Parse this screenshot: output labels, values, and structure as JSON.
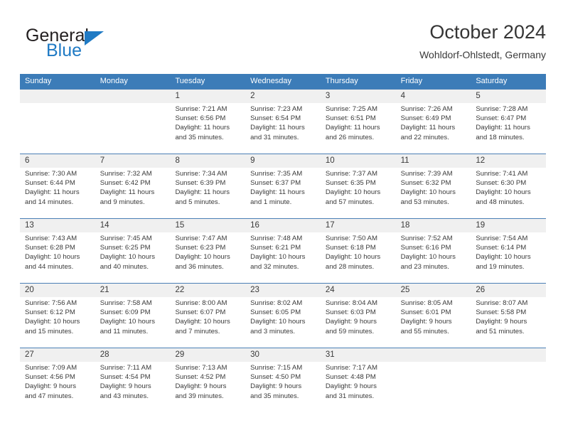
{
  "brand": {
    "name_part1": "General",
    "name_part2": "Blue",
    "triangle_color": "#1f7ac4"
  },
  "header": {
    "title": "October 2024",
    "subtitle": "Wohldorf-Ohlstedt, Germany"
  },
  "colors": {
    "header_blue": "#3c7cb8",
    "daynum_band": "#f0f0f0",
    "row_divider": "#4a7fb5",
    "text": "#3a3a3a"
  },
  "weekdays": [
    "Sunday",
    "Monday",
    "Tuesday",
    "Wednesday",
    "Thursday",
    "Friday",
    "Saturday"
  ],
  "weeks": [
    [
      {
        "day": "",
        "lines": [
          "",
          "",
          "",
          ""
        ]
      },
      {
        "day": "",
        "lines": [
          "",
          "",
          "",
          ""
        ]
      },
      {
        "day": "1",
        "lines": [
          "Sunrise: 7:21 AM",
          "Sunset: 6:56 PM",
          "Daylight: 11 hours",
          "and 35 minutes."
        ]
      },
      {
        "day": "2",
        "lines": [
          "Sunrise: 7:23 AM",
          "Sunset: 6:54 PM",
          "Daylight: 11 hours",
          "and 31 minutes."
        ]
      },
      {
        "day": "3",
        "lines": [
          "Sunrise: 7:25 AM",
          "Sunset: 6:51 PM",
          "Daylight: 11 hours",
          "and 26 minutes."
        ]
      },
      {
        "day": "4",
        "lines": [
          "Sunrise: 7:26 AM",
          "Sunset: 6:49 PM",
          "Daylight: 11 hours",
          "and 22 minutes."
        ]
      },
      {
        "day": "5",
        "lines": [
          "Sunrise: 7:28 AM",
          "Sunset: 6:47 PM",
          "Daylight: 11 hours",
          "and 18 minutes."
        ]
      }
    ],
    [
      {
        "day": "6",
        "lines": [
          "Sunrise: 7:30 AM",
          "Sunset: 6:44 PM",
          "Daylight: 11 hours",
          "and 14 minutes."
        ]
      },
      {
        "day": "7",
        "lines": [
          "Sunrise: 7:32 AM",
          "Sunset: 6:42 PM",
          "Daylight: 11 hours",
          "and 9 minutes."
        ]
      },
      {
        "day": "8",
        "lines": [
          "Sunrise: 7:34 AM",
          "Sunset: 6:39 PM",
          "Daylight: 11 hours",
          "and 5 minutes."
        ]
      },
      {
        "day": "9",
        "lines": [
          "Sunrise: 7:35 AM",
          "Sunset: 6:37 PM",
          "Daylight: 11 hours",
          "and 1 minute."
        ]
      },
      {
        "day": "10",
        "lines": [
          "Sunrise: 7:37 AM",
          "Sunset: 6:35 PM",
          "Daylight: 10 hours",
          "and 57 minutes."
        ]
      },
      {
        "day": "11",
        "lines": [
          "Sunrise: 7:39 AM",
          "Sunset: 6:32 PM",
          "Daylight: 10 hours",
          "and 53 minutes."
        ]
      },
      {
        "day": "12",
        "lines": [
          "Sunrise: 7:41 AM",
          "Sunset: 6:30 PM",
          "Daylight: 10 hours",
          "and 48 minutes."
        ]
      }
    ],
    [
      {
        "day": "13",
        "lines": [
          "Sunrise: 7:43 AM",
          "Sunset: 6:28 PM",
          "Daylight: 10 hours",
          "and 44 minutes."
        ]
      },
      {
        "day": "14",
        "lines": [
          "Sunrise: 7:45 AM",
          "Sunset: 6:25 PM",
          "Daylight: 10 hours",
          "and 40 minutes."
        ]
      },
      {
        "day": "15",
        "lines": [
          "Sunrise: 7:47 AM",
          "Sunset: 6:23 PM",
          "Daylight: 10 hours",
          "and 36 minutes."
        ]
      },
      {
        "day": "16",
        "lines": [
          "Sunrise: 7:48 AM",
          "Sunset: 6:21 PM",
          "Daylight: 10 hours",
          "and 32 minutes."
        ]
      },
      {
        "day": "17",
        "lines": [
          "Sunrise: 7:50 AM",
          "Sunset: 6:18 PM",
          "Daylight: 10 hours",
          "and 28 minutes."
        ]
      },
      {
        "day": "18",
        "lines": [
          "Sunrise: 7:52 AM",
          "Sunset: 6:16 PM",
          "Daylight: 10 hours",
          "and 23 minutes."
        ]
      },
      {
        "day": "19",
        "lines": [
          "Sunrise: 7:54 AM",
          "Sunset: 6:14 PM",
          "Daylight: 10 hours",
          "and 19 minutes."
        ]
      }
    ],
    [
      {
        "day": "20",
        "lines": [
          "Sunrise: 7:56 AM",
          "Sunset: 6:12 PM",
          "Daylight: 10 hours",
          "and 15 minutes."
        ]
      },
      {
        "day": "21",
        "lines": [
          "Sunrise: 7:58 AM",
          "Sunset: 6:09 PM",
          "Daylight: 10 hours",
          "and 11 minutes."
        ]
      },
      {
        "day": "22",
        "lines": [
          "Sunrise: 8:00 AM",
          "Sunset: 6:07 PM",
          "Daylight: 10 hours",
          "and 7 minutes."
        ]
      },
      {
        "day": "23",
        "lines": [
          "Sunrise: 8:02 AM",
          "Sunset: 6:05 PM",
          "Daylight: 10 hours",
          "and 3 minutes."
        ]
      },
      {
        "day": "24",
        "lines": [
          "Sunrise: 8:04 AM",
          "Sunset: 6:03 PM",
          "Daylight: 9 hours",
          "and 59 minutes."
        ]
      },
      {
        "day": "25",
        "lines": [
          "Sunrise: 8:05 AM",
          "Sunset: 6:01 PM",
          "Daylight: 9 hours",
          "and 55 minutes."
        ]
      },
      {
        "day": "26",
        "lines": [
          "Sunrise: 8:07 AM",
          "Sunset: 5:58 PM",
          "Daylight: 9 hours",
          "and 51 minutes."
        ]
      }
    ],
    [
      {
        "day": "27",
        "lines": [
          "Sunrise: 7:09 AM",
          "Sunset: 4:56 PM",
          "Daylight: 9 hours",
          "and 47 minutes."
        ]
      },
      {
        "day": "28",
        "lines": [
          "Sunrise: 7:11 AM",
          "Sunset: 4:54 PM",
          "Daylight: 9 hours",
          "and 43 minutes."
        ]
      },
      {
        "day": "29",
        "lines": [
          "Sunrise: 7:13 AM",
          "Sunset: 4:52 PM",
          "Daylight: 9 hours",
          "and 39 minutes."
        ]
      },
      {
        "day": "30",
        "lines": [
          "Sunrise: 7:15 AM",
          "Sunset: 4:50 PM",
          "Daylight: 9 hours",
          "and 35 minutes."
        ]
      },
      {
        "day": "31",
        "lines": [
          "Sunrise: 7:17 AM",
          "Sunset: 4:48 PM",
          "Daylight: 9 hours",
          "and 31 minutes."
        ]
      },
      {
        "day": "",
        "lines": [
          "",
          "",
          "",
          ""
        ]
      },
      {
        "day": "",
        "lines": [
          "",
          "",
          "",
          ""
        ]
      }
    ]
  ]
}
